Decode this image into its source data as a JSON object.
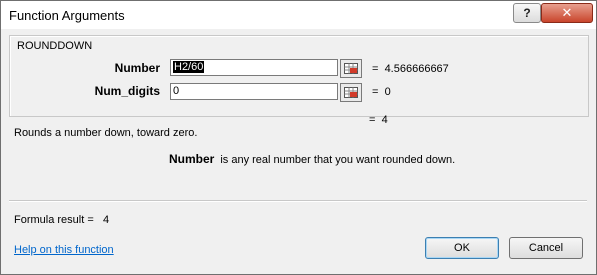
{
  "window": {
    "title": "Function Arguments",
    "help_button": "?",
    "close_button": "✕"
  },
  "function": {
    "name": "ROUNDDOWN",
    "args": [
      {
        "label": "Number",
        "value": "H2/60",
        "result": "4.566666667"
      },
      {
        "label": "Num_digits",
        "value": "0",
        "result": "0"
      }
    ],
    "result": "4",
    "equals": "=",
    "description": "Rounds a number down, toward zero.",
    "arg_description": {
      "name": "Number",
      "text": "is any real number that you want rounded down."
    }
  },
  "footer": {
    "formula_result_label": "Formula result =",
    "formula_result_value": "4",
    "help_link": "Help on this function",
    "ok_label": "OK",
    "cancel_label": "Cancel"
  },
  "icons": {
    "ref": "collapse-dialog-icon"
  }
}
